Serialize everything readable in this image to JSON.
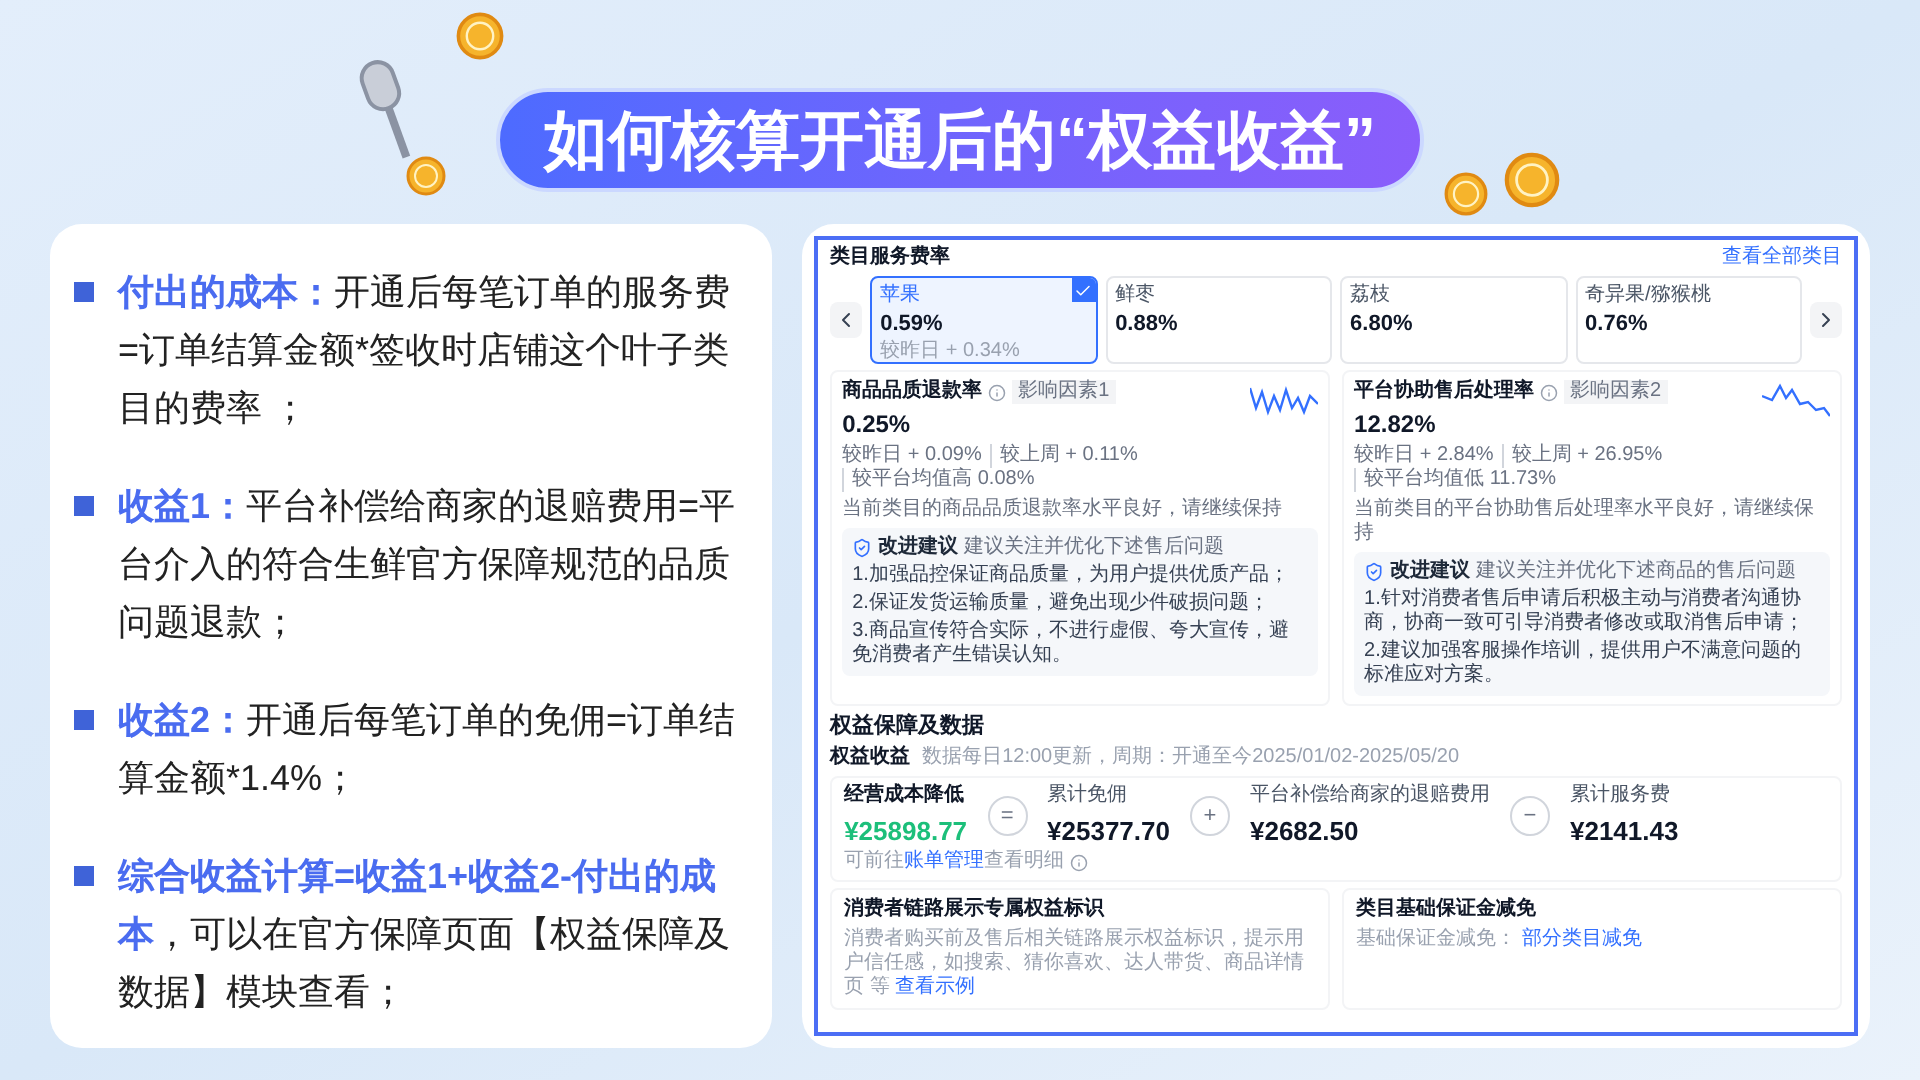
{
  "title": "如何核算开通后的“权益收益”",
  "points": [
    {
      "label": "付出的成本：",
      "text": "开通后每笔订单的服务费=订单结算金额*签收时店铺这个叶子类目的费率 ；"
    },
    {
      "label": "收益1：",
      "text": "平台补偿给商家的退赔费用=平台介入的符合生鲜官方保障规范的品质问题退款；"
    },
    {
      "label": "收益2：",
      "text": "开通后每笔订单的免佣=订单结算金额*1.4%；"
    },
    {
      "label": "综合收益计算=收益1+收益2-付出的成本",
      "text": "，可以在官方保障页面【权益保障及数据】模块查看；"
    }
  ],
  "screenshot": {
    "fee_section": {
      "title": "类目服务费率",
      "link": "查看全部类目",
      "categories": [
        {
          "name": "苹果",
          "rate": "0.59%",
          "change": "较昨日 + 0.34%",
          "selected": true
        },
        {
          "name": "鲜枣",
          "rate": "0.88%",
          "selected": false
        },
        {
          "name": "荔枝",
          "rate": "6.80%",
          "selected": false
        },
        {
          "name": "奇异果/猕猴桃",
          "rate": "0.76%",
          "selected": false
        }
      ],
      "metrics": [
        {
          "title": "商品品质退款率",
          "tag": "影响因素1",
          "value": "0.25%",
          "comparisons": [
            "较昨日 + 0.09%",
            "较上周 + 0.11%",
            "较平台均值高 0.08%"
          ],
          "note": "当前类目的商品品质退款率水平良好，请继续保持",
          "advice": {
            "label": "改进建议",
            "hint": "建议关注并优化下述售后问题",
            "lines": [
              "1.加强品控保证商品质量，为用户提供优质产品；",
              "2.保证发货运输质量，避免出现少件破损问题；",
              "3.商品宣传符合实际，不进行虚假、夸大宣传，避免消费者产生错误认知。"
            ]
          }
        },
        {
          "title": "平台协助售后处理率",
          "tag": "影响因素2",
          "value": "12.82%",
          "comparisons": [
            "较昨日 + 2.84%",
            "较上周 + 26.95%",
            "较平台均值低 11.73%"
          ],
          "note": "当前类目的平台协助售后处理率水平良好，请继续保持",
          "advice": {
            "label": "改进建议",
            "hint": "建议关注并优化下述商品的售后问题",
            "lines": [
              "1.针对消费者售后申请后积极主动与消费者沟通协商，协商一致可引导消费者修改或取消售后申请；",
              "2.建议加强客服操作培训，提供用户不满意问题的标准应对方案。"
            ]
          }
        }
      ]
    },
    "benefits": {
      "title": "权益保障及数据",
      "subtitle": "权益收益",
      "update": "数据每日12:00更新，周期：开通至今2025/01/02-2025/05/20",
      "formula": [
        {
          "kind": "result",
          "label": "经营成本降低",
          "value": "¥25898.77"
        },
        {
          "kind": "operator",
          "symbol": "="
        },
        {
          "kind": "term",
          "label": "累计免佣",
          "value": "¥25377.70"
        },
        {
          "kind": "operator",
          "symbol": "+"
        },
        {
          "kind": "term",
          "label": "平台补偿给商家的退赔费用",
          "value": "¥2682.50"
        },
        {
          "kind": "operator",
          "symbol": "−"
        },
        {
          "kind": "term",
          "label": "累计服务费",
          "value": "¥2141.43"
        }
      ],
      "formula_note": {
        "prefix": "可前往",
        "link": "账单管理",
        "suffix": "查看明细"
      },
      "cards": [
        {
          "title": "消费者链路展示专属权益标识",
          "text": "消费者购买前及售后相关链路展示权益标识，提示用户信任感，如搜索、猜你喜欢、达人带货、商品详情页 等",
          "link": "查看示例"
        },
        {
          "title": "类目基础保证金减免",
          "text": "基础保证金减免：",
          "link": "部分类目减免"
        }
      ]
    }
  }
}
